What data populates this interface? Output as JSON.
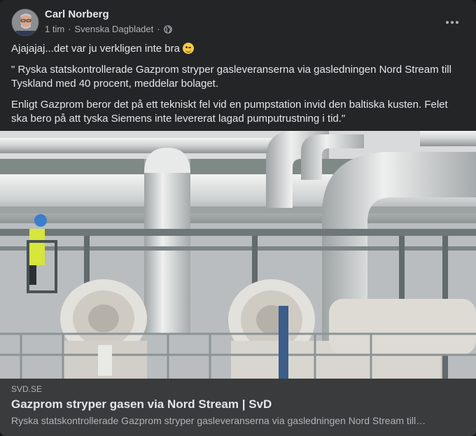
{
  "post": {
    "author": "Carl Norberg",
    "time": "1 tim",
    "separator": "·",
    "source": "Svenska Dagbladet",
    "separator2": "·",
    "icons": {
      "privacy": "globe-icon",
      "menu": "more-options-icon"
    },
    "paragraphs": [
      "Ajajajaj...det var ju verkligen inte bra",
      "\" Ryska statskontrollerade Gazprom stryper gasleveranserna via gasledningen Nord Stream till Tyskland med 40 procent, meddelar bolaget.",
      "Enligt Gazprom beror det på ett tekniskt fel vid en pumpstation invid den baltiska kusten. Felet ska bero på att tyska Siemens inte levererat lagad pumputrustning i tid.\""
    ],
    "emoji": "wink-face-emoji"
  },
  "link": {
    "domain": "SVD.SE",
    "title": "Gazprom stryper gasen via Nord Stream | SvD",
    "description": "Ryska statskontrollerade Gazprom stryper gasleveranserna via gasledningen Nord Stream till…"
  },
  "colors": {
    "card": "#242526",
    "link_box": "#3a3b3c",
    "text_primary": "#e4e6eb",
    "text_secondary": "#b0b3b8"
  }
}
